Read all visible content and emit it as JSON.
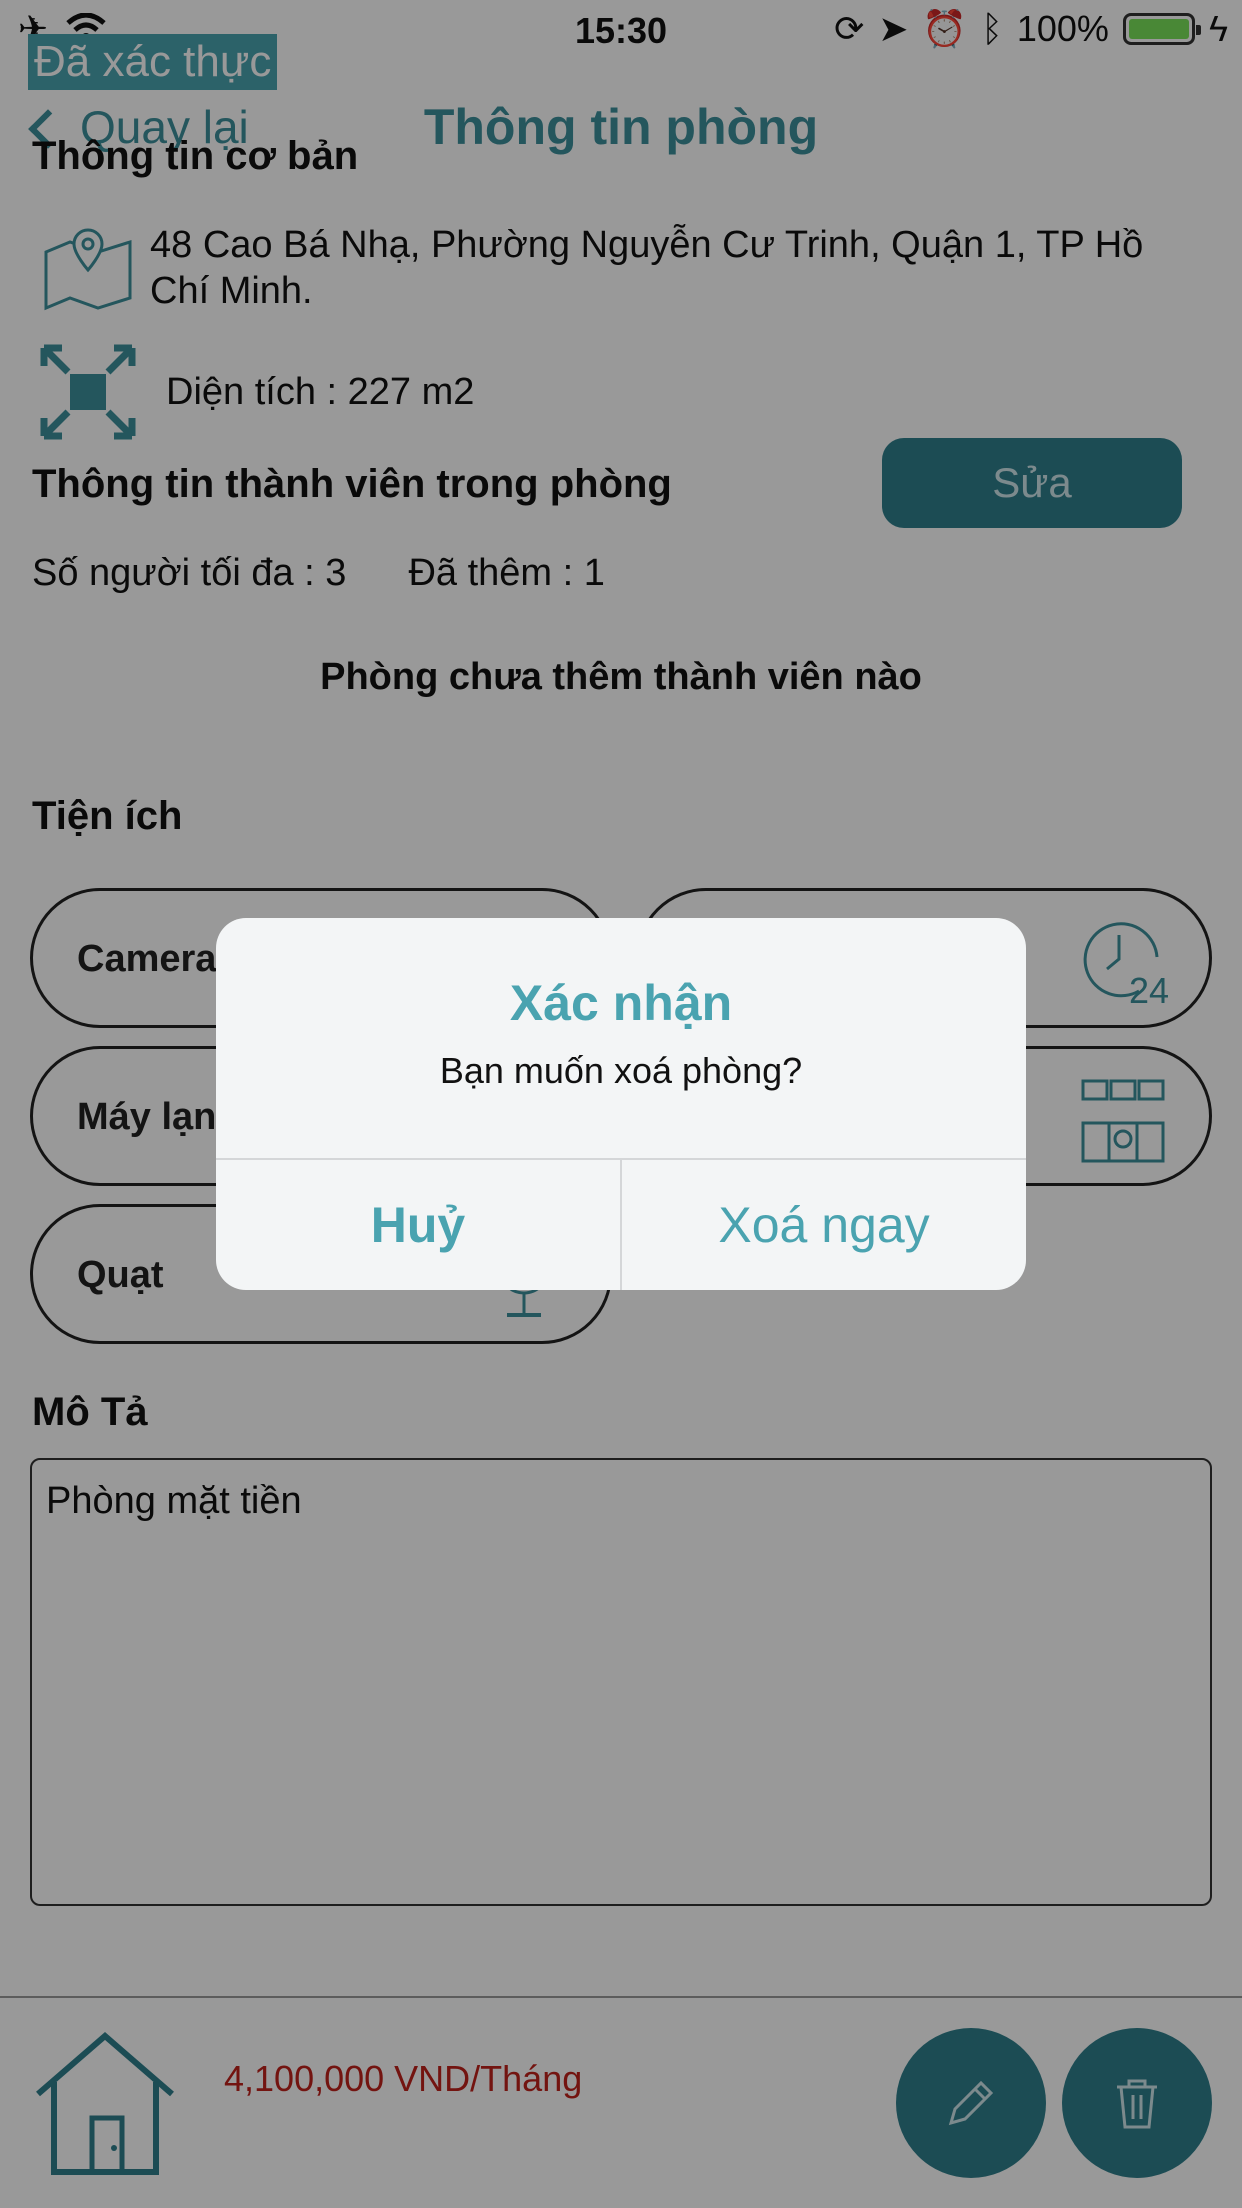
{
  "status_bar": {
    "time": "15:30",
    "battery_text": "100%",
    "icons": [
      "airplane-icon",
      "wifi-icon",
      "rotation-lock-icon",
      "location-icon",
      "alarm-icon",
      "bluetooth-icon",
      "battery-icon",
      "charging-icon"
    ]
  },
  "verified_label": "Đã xác thực",
  "nav": {
    "back_label": "Quay lại",
    "title": "Thông tin phòng"
  },
  "basic_info": {
    "heading": "Thông tin cơ bản",
    "address": "48 Cao Bá Nhạ, Phường Nguyễn Cư Trinh, Quận 1, TP Hồ Chí Minh.",
    "area": "Diện tích : 227 m2"
  },
  "members": {
    "heading": "Thông tin thành viên trong phòng",
    "edit_label": "Sửa",
    "max_people": "Số người tối đa : 3",
    "added": "Đã thêm : 1",
    "empty_message": "Phòng chưa thêm thành viên nào"
  },
  "amenities": {
    "heading": "Tiện ích",
    "items": [
      {
        "label": "Camera",
        "icon": "camera-icon"
      },
      {
        "label": "",
        "icon": "clock-24h-icon"
      },
      {
        "label": "Máy lạnh",
        "icon": "air-conditioner-icon"
      },
      {
        "label": "",
        "icon": "kitchen-icon"
      },
      {
        "label": "Quạt",
        "icon": "fan-icon"
      }
    ]
  },
  "description": {
    "heading": "Mô Tả",
    "text": "Phòng mặt tiền"
  },
  "footer": {
    "price": "4,100,000 VND/Tháng",
    "icons": [
      "house-icon",
      "pencil-icon",
      "trash-icon"
    ]
  },
  "dialog": {
    "title": "Xác nhận",
    "message": "Bạn muốn xoá phòng?",
    "cancel_label": "Huỷ",
    "confirm_label": "Xoá ngay"
  },
  "colors": {
    "accent": "#4aa3b0",
    "button_dark": "#2f7f8c",
    "price": "#c0221c"
  }
}
